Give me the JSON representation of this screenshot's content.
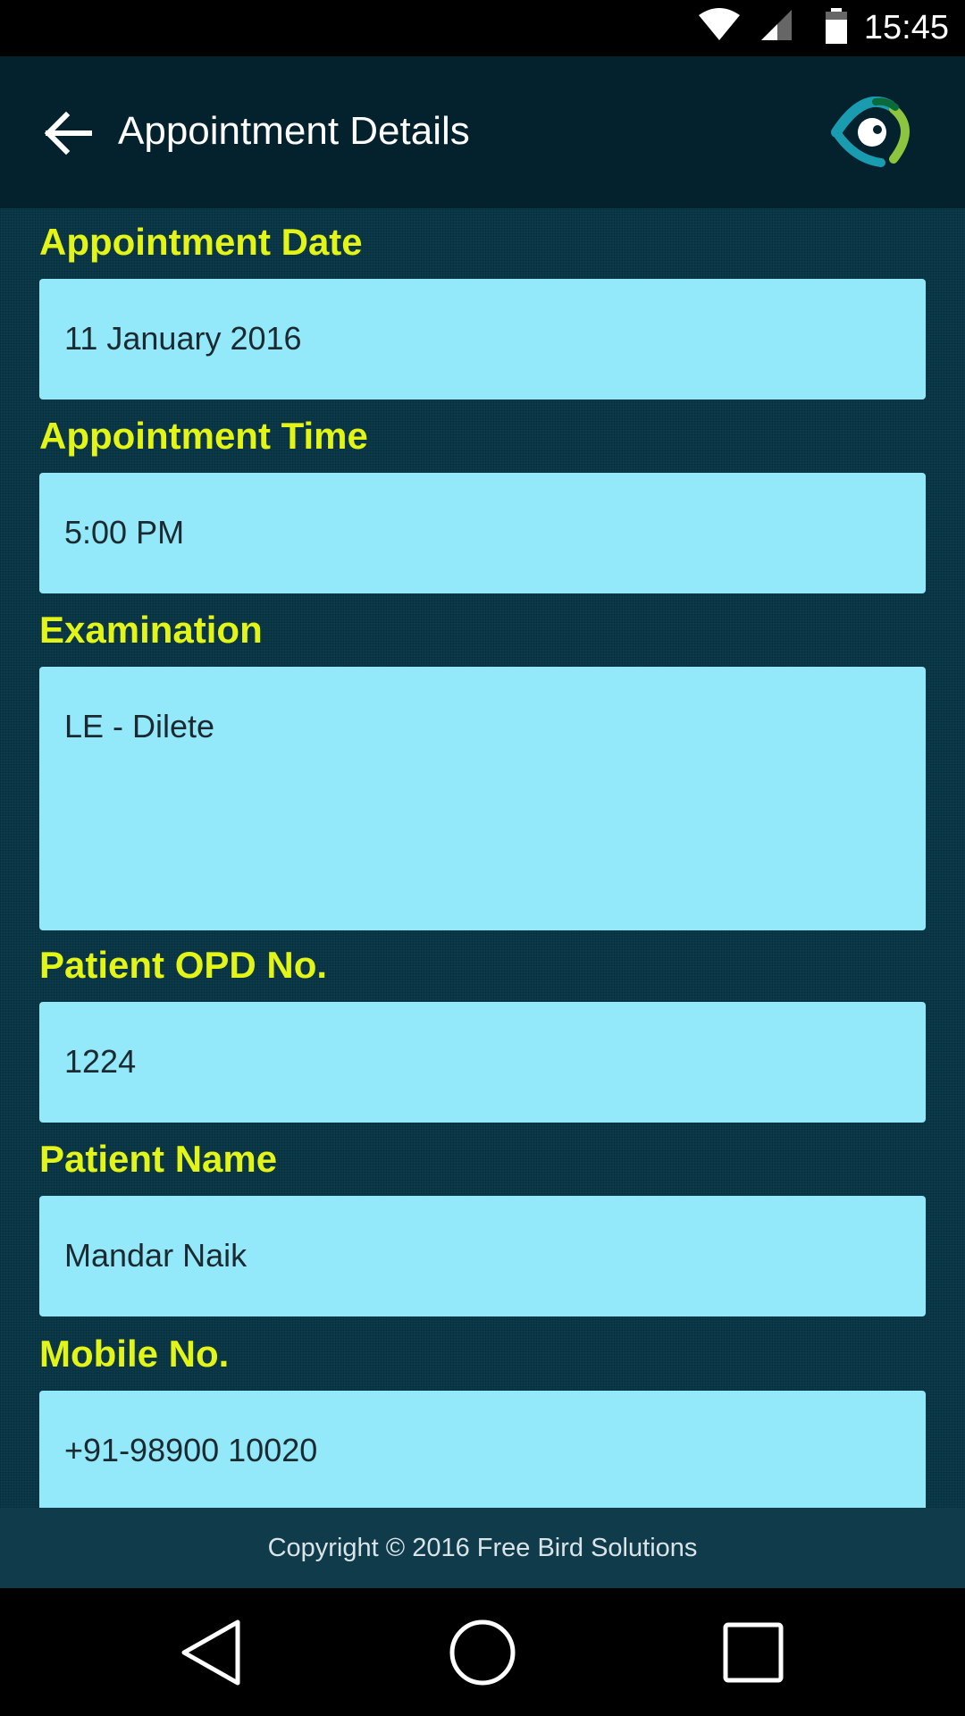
{
  "status_bar": {
    "time": "15:45",
    "icons": [
      "wifi-icon",
      "cellular-signal-icon",
      "battery-icon"
    ]
  },
  "app_bar": {
    "title": "Appointment Details",
    "back_icon": "arrow-left-icon",
    "logo_icon": "eye-logo-icon"
  },
  "fields": [
    {
      "label": "Appointment Date",
      "value": "11 January 2016"
    },
    {
      "label": "Appointment Time",
      "value": "5:00 PM"
    },
    {
      "label": "Examination",
      "value": "LE - Dilete"
    },
    {
      "label": "Patient OPD No.",
      "value": "1224"
    },
    {
      "label": "Patient Name",
      "value": "Mandar Naik"
    },
    {
      "label": "Mobile No.",
      "value": "+91-98900 10020"
    }
  ],
  "footer": {
    "copyright": "Copyright © 2016 Free Bird Solutions"
  },
  "nav_bar": {
    "icons": [
      "back-triangle-icon",
      "home-circle-icon",
      "recents-square-icon"
    ]
  },
  "colors": {
    "app_bar": "#03222d",
    "content_bg": "#0b3a4a",
    "label": "#e3f516",
    "field_bg": "#93e8f9",
    "footer_bg": "#0f3b4b"
  }
}
